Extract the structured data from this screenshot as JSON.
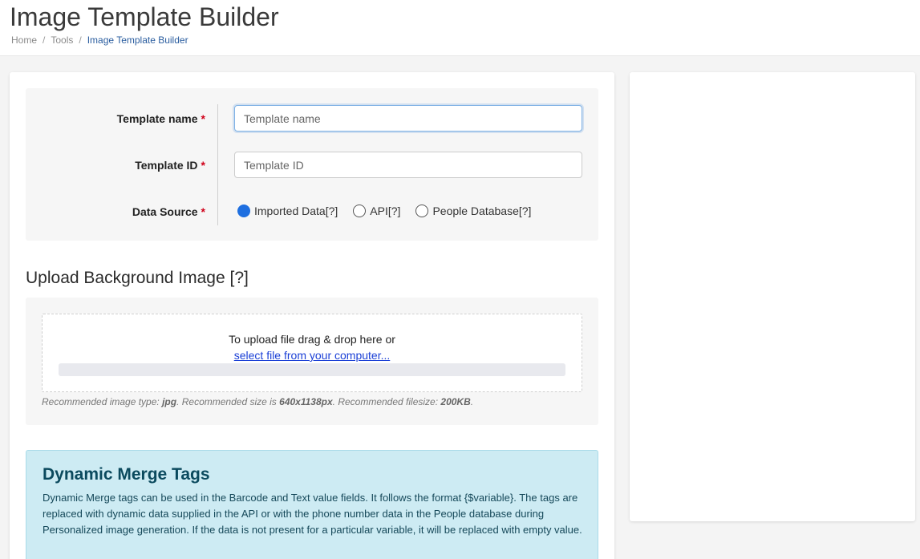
{
  "header": {
    "title": "Image Template Builder",
    "breadcrumb": [
      {
        "label": "Home",
        "link": true
      },
      {
        "label": "Tools",
        "link": true
      },
      {
        "label": "Image Template Builder",
        "link": false
      }
    ],
    "separator": "/"
  },
  "form": {
    "template_name": {
      "label": "Template name",
      "required_mark": "*",
      "value": "",
      "placeholder": "Template name"
    },
    "template_id": {
      "label": "Template ID",
      "required_mark": "*",
      "value": "",
      "placeholder": "Template ID"
    },
    "data_source": {
      "label": "Data Source",
      "required_mark": "*",
      "options": [
        {
          "label": "Imported Data",
          "help": "[?]",
          "checked": true
        },
        {
          "label": "API",
          "help": "[?]",
          "checked": false
        },
        {
          "label": "People Database",
          "help": "[?]",
          "checked": false
        }
      ]
    }
  },
  "upload": {
    "title": "Upload Background Image [?]",
    "drop_text": "To upload file drag & drop here or",
    "select_link": "select file from your computer...",
    "progress_percent": 0,
    "hint": {
      "p1": "Recommended image type: ",
      "type": "jpg",
      "p2": ". Recommended size is ",
      "size": "640x1138px",
      "p3": ". Recommended filesize: ",
      "filesize": "200KB",
      "p4": "."
    }
  },
  "merge_tags": {
    "title": "Dynamic Merge Tags",
    "body": "Dynamic Merge tags can be used in the Barcode and Text value fields. It follows the format {$variable}. The tags are replaced with dynamic data supplied in the API or with the phone number data in the People database during Personalized image generation. If the data is not present for a particular variable, it will be replaced with empty value."
  },
  "colors": {
    "accent": "#1e6fe0",
    "required": "#d0021b",
    "link": "#1a3fd6",
    "info_bg": "#cdebf3",
    "info_text": "#16495a"
  }
}
